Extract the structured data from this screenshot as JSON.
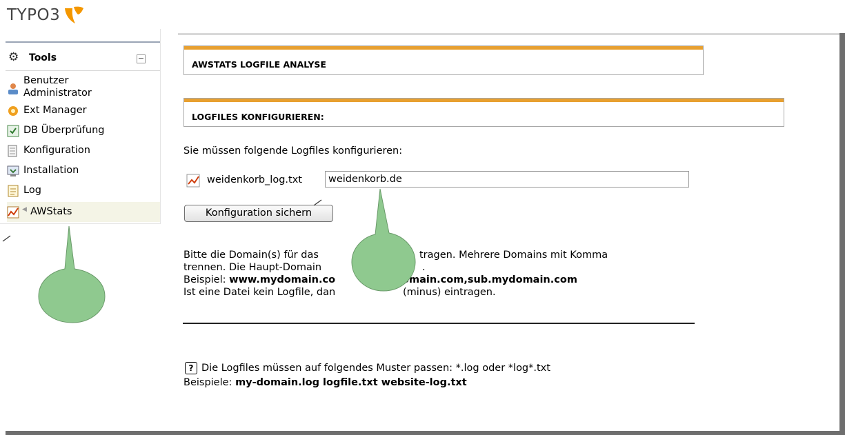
{
  "header": {
    "logo_text": "TYPO3"
  },
  "sidebar": {
    "section_title": "Tools",
    "collapse_symbol": "−",
    "items": [
      {
        "label_line1": "Benutzer",
        "label_line2": "Administrator",
        "icon": "user-admin-icon"
      },
      {
        "label": "Ext Manager",
        "icon": "ext-manager-icon"
      },
      {
        "label": "DB Überprüfung",
        "icon": "db-check-icon"
      },
      {
        "label": "Konfiguration",
        "icon": "configuration-icon"
      },
      {
        "label": "Installation",
        "icon": "installation-icon"
      },
      {
        "label": "Log",
        "icon": "log-icon"
      },
      {
        "label": "AWStats",
        "icon": "awstats-icon"
      }
    ]
  },
  "main": {
    "title": "AWSTATS LOGFILE ANALYSE",
    "section_title": "LOGFILES KONFIGURIEREN:",
    "intro": "Sie müssen folgende Logfiles konfigurieren:",
    "logfile": {
      "name": "weidenkorb_log.txt",
      "value": "weidenkorb.de"
    },
    "save_button": "Konfiguration sichern",
    "info": {
      "line1": "Bitte die Domain(s) für das",
      "line1b": "tragen. Mehrere Domains mit Komma",
      "line2": "trennen. Die Haupt-Domain",
      "line2b": ".",
      "line3_prefix": "Beispiel: ",
      "line3_bold_a": "www.mydomain.co",
      "line3_bold_b": "omain.com,sub.mydomain.com",
      "line4a": "Ist eine Datei kein Logfile, dan",
      "line4b": "(minus) eintragen."
    },
    "help": {
      "icon_symbol": "?",
      "line1": "Die Logfiles müssen auf folgendes Muster passen: *.log oder *log*.txt",
      "line2_prefix": "Beispiele: ",
      "line2_bold": "my-domain.log logfile.txt website-log.txt"
    }
  },
  "colors": {
    "accent_orange": "#e8a030",
    "balloon_green": "#8fc98f"
  }
}
